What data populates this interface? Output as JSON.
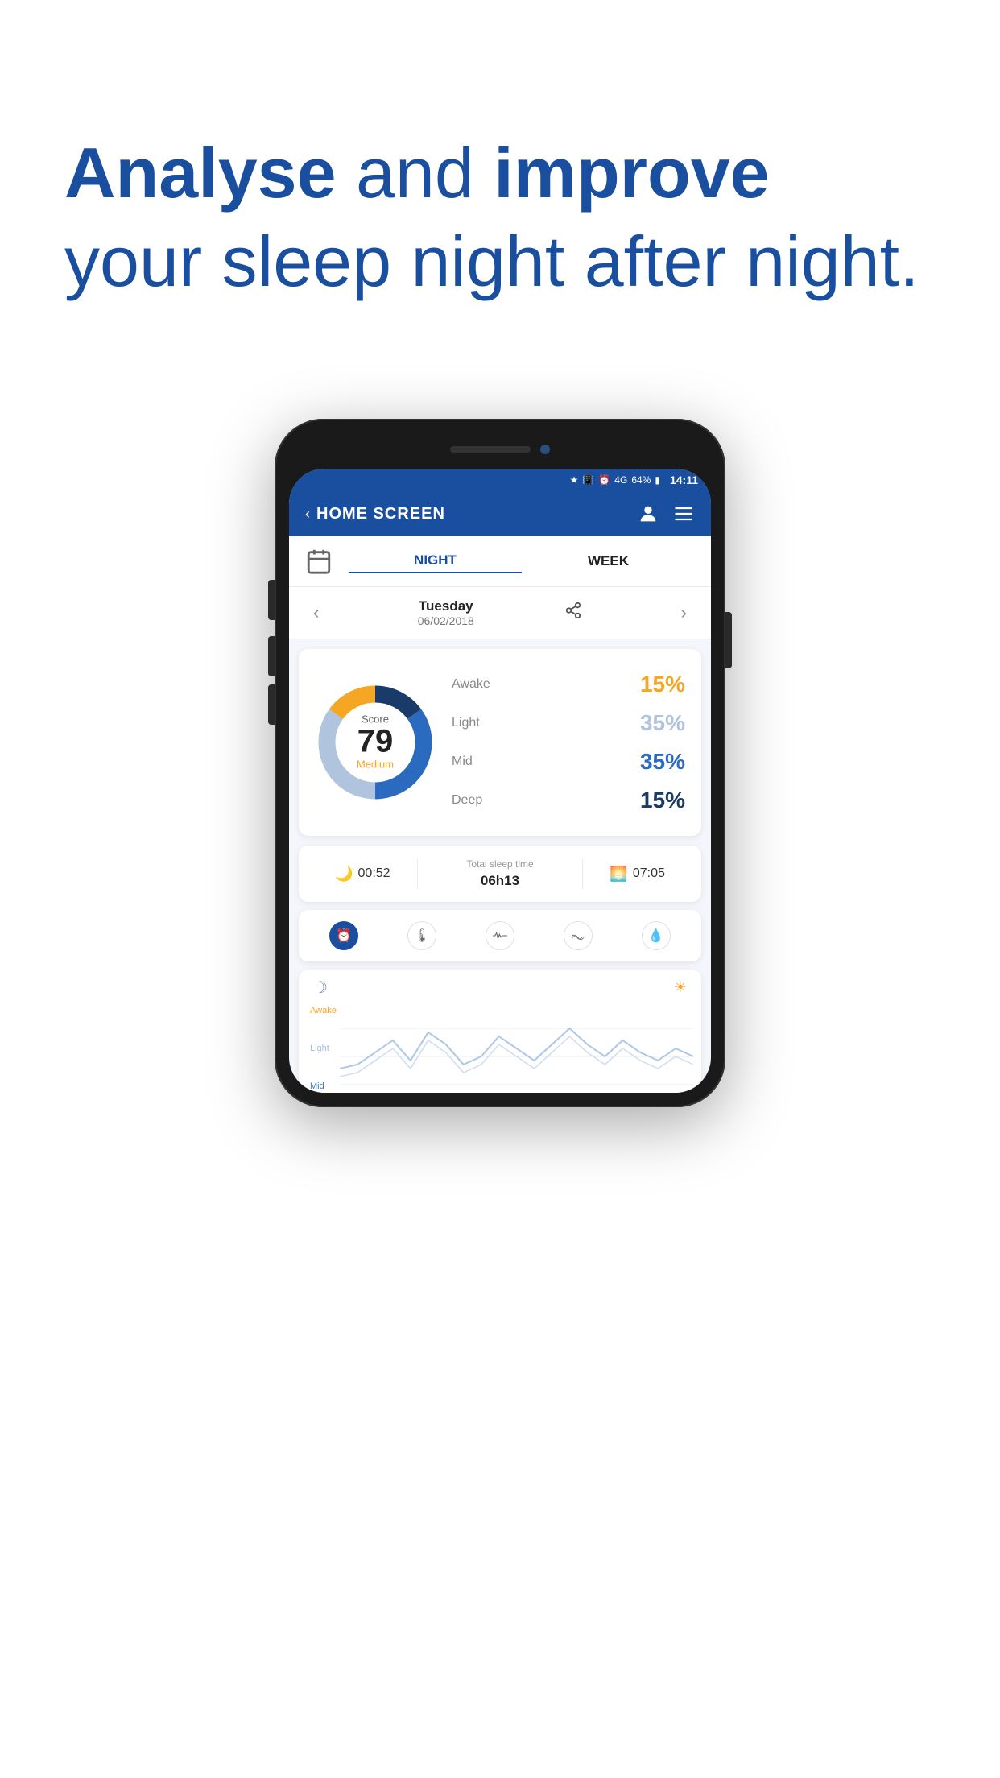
{
  "hero": {
    "line1_normal": " and ",
    "line1_bold1": "Analyse",
    "line1_bold2": "improve",
    "line2": "your sleep night after night.",
    "full_text": "Analyse and improve your sleep night after night."
  },
  "status_bar": {
    "battery": "64%",
    "time": "14:11",
    "signal": "4G"
  },
  "nav": {
    "title": "HOME SCREEN",
    "back_label": "<"
  },
  "tabs": {
    "calendar_icon": "📅",
    "night_label": "NIGHT",
    "week_label": "WEEK",
    "active": "night"
  },
  "date": {
    "day": "Tuesday",
    "full": "06/02/2018"
  },
  "score": {
    "value": 79,
    "label": "Score",
    "quality": "Medium"
  },
  "sleep_stages": {
    "awake": {
      "label": "Awake",
      "value": "15%",
      "pct": 15
    },
    "light": {
      "label": "Light",
      "value": "35%",
      "pct": 35
    },
    "mid": {
      "label": "Mid",
      "value": "35%",
      "pct": 35
    },
    "deep": {
      "label": "Deep",
      "value": "15%",
      "pct": 15
    }
  },
  "times": {
    "sleep_start": "00:52",
    "total_label": "Total sleep time",
    "total_value": "06h13",
    "wake_time": "07:05"
  },
  "sensors": [
    {
      "id": "alarm",
      "icon": "⏰",
      "active": true
    },
    {
      "id": "temp",
      "icon": "🌡",
      "active": false
    },
    {
      "id": "heartrate",
      "icon": "〜",
      "active": false
    },
    {
      "id": "snore",
      "icon": "💤",
      "active": false
    },
    {
      "id": "water",
      "icon": "💧",
      "active": false
    }
  ],
  "chart": {
    "moon_icon": "☽",
    "sun_icon": "☀",
    "stage_labels": [
      "Awake",
      "Light",
      "Mid"
    ]
  },
  "colors": {
    "primary_blue": "#1a4fa0",
    "awake_orange": "#f5a623",
    "light_blue": "#b0c4de",
    "mid_blue": "#2a6bbf",
    "deep_blue": "#1a3a6a",
    "donut_bg": "#e8eef8"
  }
}
